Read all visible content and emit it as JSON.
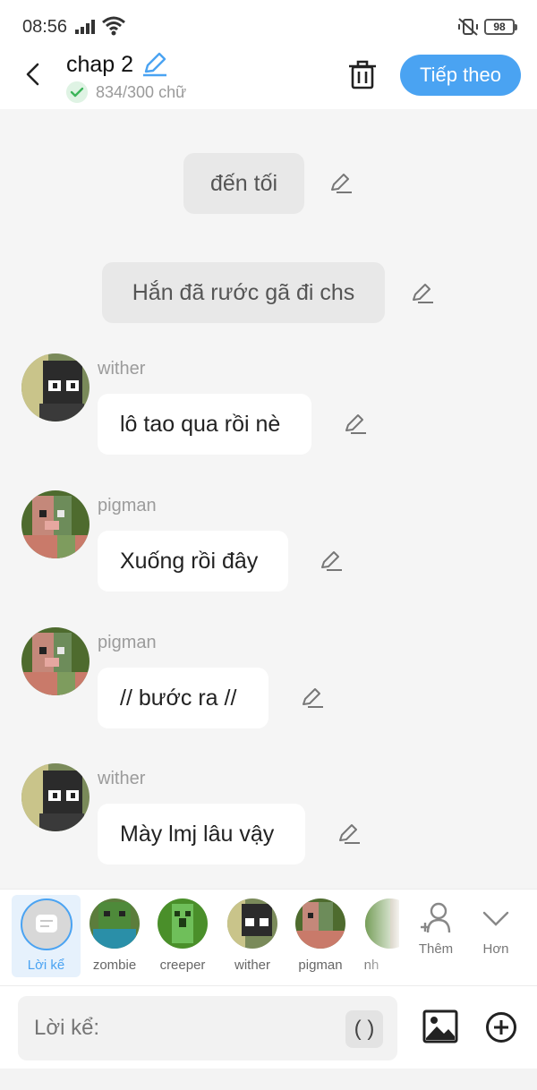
{
  "status": {
    "time": "08:56",
    "battery": "98"
  },
  "header": {
    "title": "chap 2",
    "count": "834/300 chữ",
    "next_label": "Tiếp theo"
  },
  "messages": {
    "narration1": "đến tối",
    "narration2": "Hắn đã rước gã đi chs",
    "m1": {
      "sender": "wither",
      "text": "lô tao qua rồi nè"
    },
    "m2": {
      "sender": "pigman",
      "text": "Xuống rồi đây"
    },
    "m3": {
      "sender": "pigman",
      "text": "// bước ra //"
    },
    "m4": {
      "sender": "wither",
      "text": "Mày lmj lâu vậy"
    }
  },
  "characters": {
    "narrator": "Lời kể",
    "zombie": "zombie",
    "creeper": "creeper",
    "wither": "wither",
    "pigman": "pigman",
    "partial": "nh",
    "add": "Thêm",
    "more": "Hơn"
  },
  "composer": {
    "placeholder": "Lời kể:",
    "paren": "( )"
  }
}
